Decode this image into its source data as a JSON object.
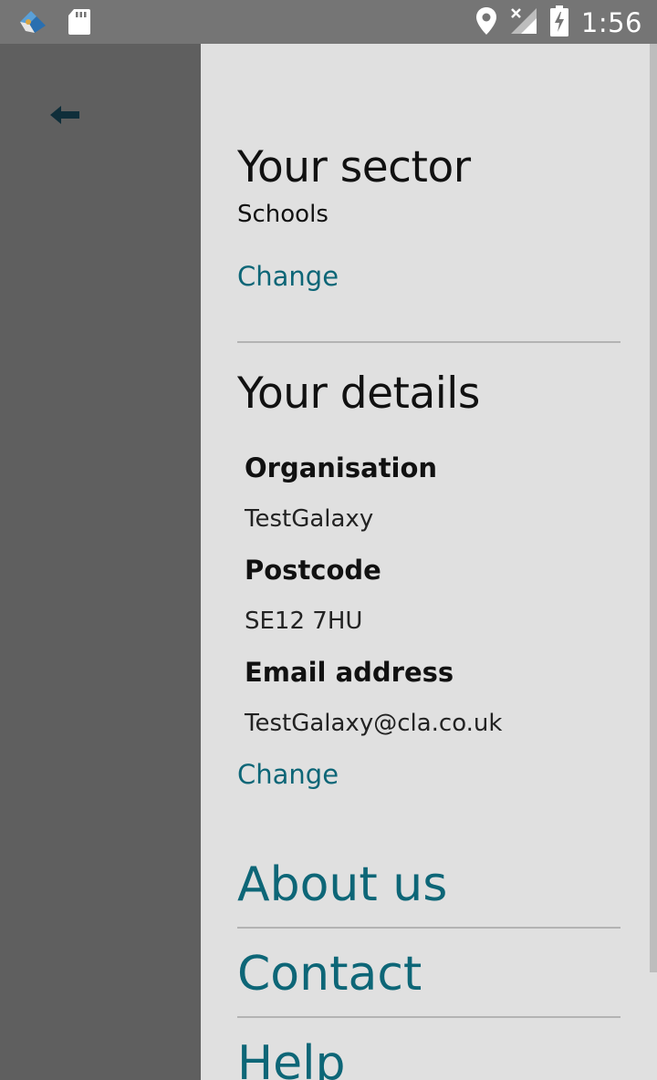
{
  "status_bar": {
    "time": "1:56",
    "icons": [
      "app-logo-icon",
      "sd-card-icon",
      "location-icon",
      "no-signal-icon",
      "battery-charging-icon"
    ]
  },
  "sector": {
    "title": "Your sector",
    "value": "Schools",
    "change_label": "Change"
  },
  "details": {
    "title": "Your details",
    "organisation_label": "Organisation",
    "organisation_value": "TestGalaxy",
    "postcode_label": "Postcode",
    "postcode_value": "SE12 7HU",
    "email_label": "Email address",
    "email_value": "TestGalaxy@cla.co.uk",
    "change_label": "Change"
  },
  "nav": {
    "about": "About us",
    "contact": "Contact",
    "help": "Help"
  },
  "colors": {
    "accent": "#0d6677",
    "drawer_bg": "#e0e0e0",
    "scrim": "#5f5f5f",
    "status_bar": "#757575"
  }
}
